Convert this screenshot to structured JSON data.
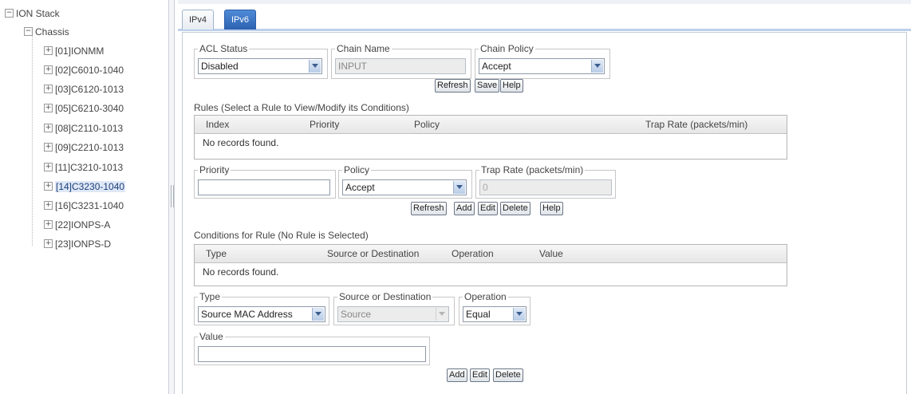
{
  "tree": {
    "root": "ION Stack",
    "chassis": "Chassis",
    "items": [
      {
        "label": "[01]IONMM"
      },
      {
        "label": "[02]C6010-1040"
      },
      {
        "label": "[03]C6120-1013"
      },
      {
        "label": "[05]C6210-3040"
      },
      {
        "label": "[08]C2110-1013"
      },
      {
        "label": "[09]C2210-1013"
      },
      {
        "label": "[11]C3210-1013"
      },
      {
        "label": "[14]C3230-1040",
        "selected": true
      },
      {
        "label": "[16]C3231-1040"
      },
      {
        "label": "[22]IONPS-A"
      },
      {
        "label": "[23]IONPS-D"
      }
    ]
  },
  "tabs": [
    {
      "label": "IPv4",
      "active": false
    },
    {
      "label": "IPv6",
      "active": true
    }
  ],
  "acl": {
    "status_label": "ACL Status",
    "status_value": "Disabled",
    "chain_name_label": "Chain Name",
    "chain_name_value": "INPUT",
    "chain_policy_label": "Chain Policy",
    "chain_policy_value": "Accept",
    "buttons": {
      "refresh": "Refresh",
      "save": "Save",
      "help": "Help"
    }
  },
  "rules": {
    "title": "Rules (Select a Rule to View/Modify its Conditions)",
    "columns": [
      "Index",
      "Priority",
      "Policy",
      "Trap Rate (packets/min)"
    ],
    "empty": "No records found.",
    "priority_label": "Priority",
    "priority_value": "",
    "policy_label": "Policy",
    "policy_value": "Accept",
    "trap_rate_label": "Trap Rate (packets/min)",
    "trap_rate_value": "0",
    "buttons": {
      "refresh": "Refresh",
      "add": "Add",
      "edit": "Edit",
      "delete": "Delete",
      "help": "Help"
    }
  },
  "conditions": {
    "title": "Conditions for Rule (No Rule is Selected)",
    "columns": [
      "Type",
      "Source or Destination",
      "Operation",
      "Value"
    ],
    "empty": "No records found.",
    "type_label": "Type",
    "type_value": "Source MAC Address",
    "src_dst_label": "Source or Destination",
    "src_dst_value": "Source",
    "operation_label": "Operation",
    "operation_value": "Equal",
    "value_label": "Value",
    "value_value": "",
    "buttons": {
      "add": "Add",
      "edit": "Edit",
      "delete": "Delete"
    }
  },
  "colors": {
    "accent": "#2d62b0",
    "selected_tree": "#dfe8f6",
    "tab_border": "#bcd0ea"
  }
}
